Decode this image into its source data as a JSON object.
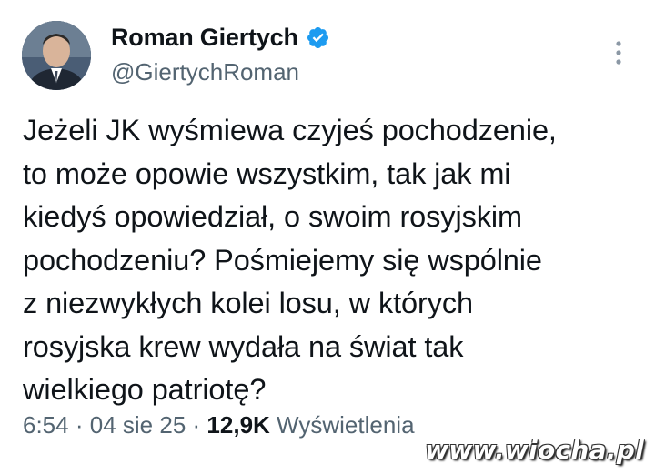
{
  "author": {
    "name": "Roman Giertych",
    "handle": "@GiertychRoman",
    "verified": true,
    "verified_color": "#1d9bf0"
  },
  "tweet": {
    "text": "Jeżeli JK wyśmiewa czyjeś pochodzenie,\nto może opowie wszystkim, tak jak mi\nkiedyś opowiedział, o swoim rosyjskim\npochodzeniu? Pośmiejemy się wspólnie\nz niezwykłych kolei losu, w których\nrosyjska krew wydała na świat tak\nwielkiego patriotę?"
  },
  "meta": {
    "time": "6:54",
    "separator": "·",
    "date": "04 sie 25",
    "views_count": "12,9K",
    "views_label": "Wyświetlenia"
  },
  "icons": {
    "verified": "verified-badge-icon",
    "more": "more-vertical-icon"
  },
  "watermark": "www.wiocha.pl"
}
